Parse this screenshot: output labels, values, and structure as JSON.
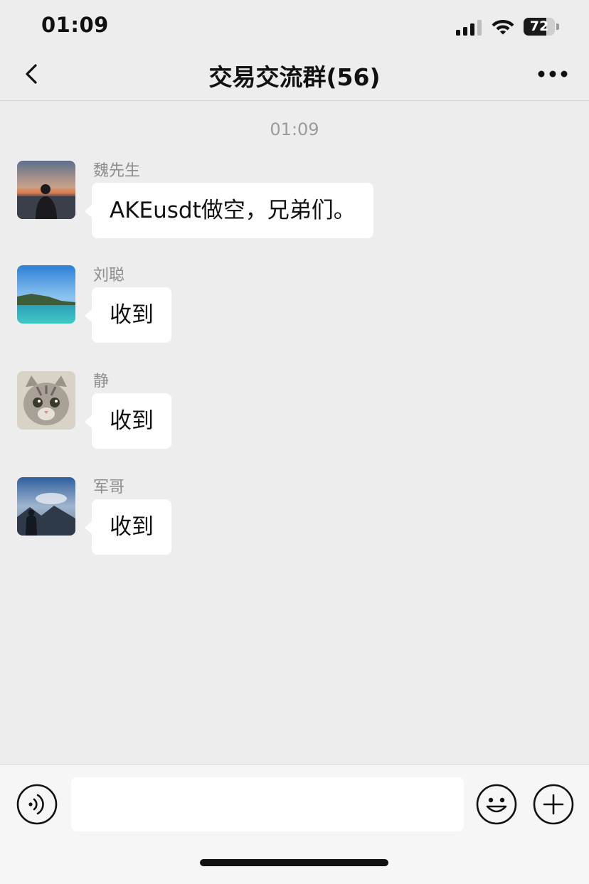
{
  "status_bar": {
    "time": "01:09",
    "battery_percent": "72",
    "battery_level": 0.72,
    "icons": [
      "cellular-signal-icon",
      "wifi-icon",
      "battery-icon"
    ]
  },
  "nav": {
    "title": "交易交流群(56)",
    "back_icon": "chevron-left-icon",
    "more_icon": "more-dots-icon"
  },
  "chat": {
    "timestamp": "01:09",
    "messages": [
      {
        "sender": "魏先生",
        "text": "AKEusdt做空，兄弟们。",
        "avatar": "sunset-silhouette-avatar"
      },
      {
        "sender": "刘聪",
        "text": "收到",
        "avatar": "ocean-coast-avatar"
      },
      {
        "sender": "静",
        "text": "收到",
        "avatar": "cat-avatar"
      },
      {
        "sender": "军哥",
        "text": "收到",
        "avatar": "mountain-sky-silhouette-avatar"
      }
    ]
  },
  "input_bar": {
    "placeholder": "",
    "value": "",
    "icons": [
      "voice-icon",
      "emoji-icon",
      "plus-icon"
    ]
  },
  "colors": {
    "background": "#ededed",
    "bubble": "#ffffff",
    "input_bar": "#f6f6f6",
    "meta_text": "#8c8c8c"
  }
}
